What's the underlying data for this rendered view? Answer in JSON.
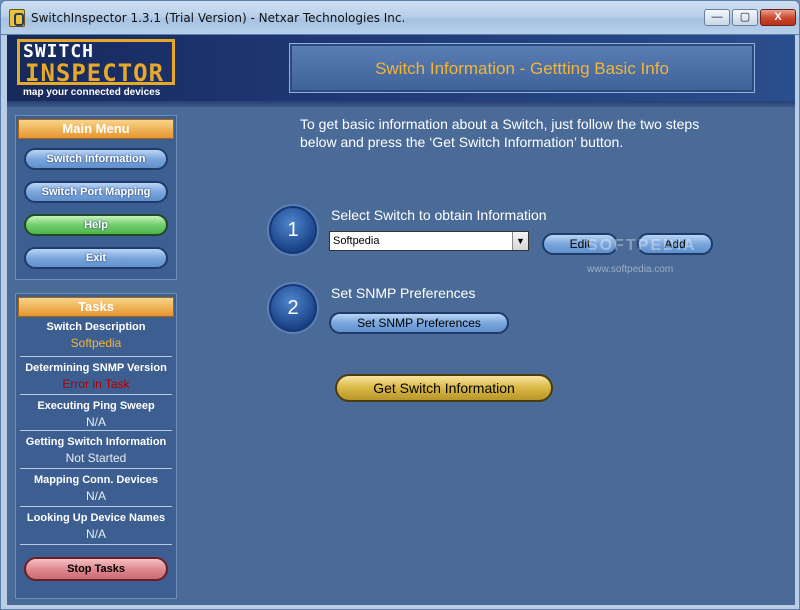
{
  "window": {
    "title": "SwitchInspector 1.3.1 (Trial Version) - Netxar Technologies Inc.",
    "controls": {
      "minimize": "—",
      "maximize": "▢",
      "close": "X"
    }
  },
  "logo": {
    "line1": "SWITCH",
    "line2": "INSPECTOR",
    "tagline": "map your connected devices"
  },
  "header": {
    "title": "Switch Information - Gettting Basic Info"
  },
  "main_menu": {
    "title": "Main Menu",
    "items": [
      {
        "label": "Switch Information"
      },
      {
        "label": "Switch Port Mapping"
      },
      {
        "label": "Help"
      },
      {
        "label": "Exit"
      }
    ]
  },
  "tasks": {
    "title": "Tasks",
    "items": [
      {
        "label": "Switch Description",
        "status": "Softpedia",
        "status_color": "#f2b53a"
      },
      {
        "label": "Determining SNMP Version",
        "status": "Error in Task",
        "status_color": "#b00000"
      },
      {
        "label": "Executing Ping Sweep",
        "status": "N/A",
        "status_color": "#e6eef8"
      },
      {
        "label": "Getting Switch Information",
        "status": "Not Started",
        "status_color": "#e6eef8"
      },
      {
        "label": "Mapping Conn. Devices",
        "status": "N/A",
        "status_color": "#e6eef8"
      },
      {
        "label": "Looking Up Device Names",
        "status": "N/A",
        "status_color": "#e6eef8"
      }
    ],
    "stop_label": "Stop Tasks"
  },
  "content": {
    "intro": "To get basic information about a Switch, just follow the two steps below and press the ‘Get Switch Information’ button.",
    "step1": {
      "number": "1",
      "label": "Select Switch to obtain Information",
      "selected_switch": "Softpedia",
      "edit_label": "Edit",
      "add_label": "Add"
    },
    "step2": {
      "number": "2",
      "label": "Set SNMP Preferences",
      "button_label": "Set SNMP Preferences"
    },
    "get_info_label": "Get Switch Information",
    "watermark": "SOFTPEDIA",
    "watermark_url": "www.softpedia.com"
  }
}
